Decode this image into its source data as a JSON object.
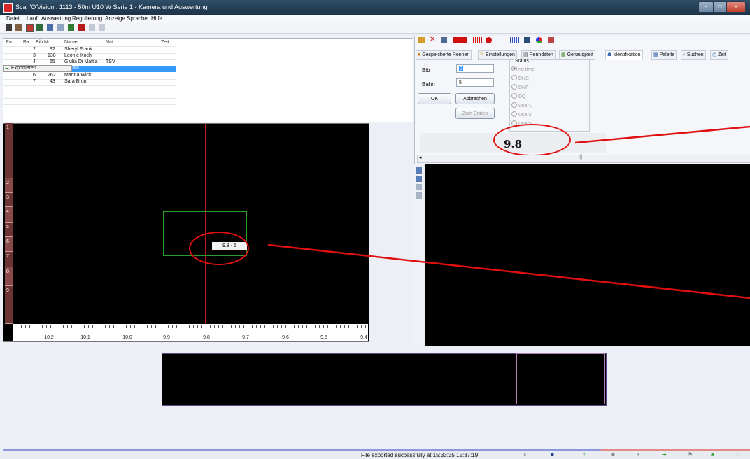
{
  "window": {
    "title": "Scan'O'Vision : 1113 - 50m  U10 W Serie 1 - Kamera und Auswertung"
  },
  "menu": [
    "Datei",
    "Lauf",
    "Auswertung",
    "Regulierung",
    "Anzeige",
    "Sprache",
    "Hilfe"
  ],
  "results_table": {
    "headers": [
      "Ra..",
      "Ba",
      "Bib Nr",
      "Name",
      "Nat",
      "Zeit"
    ],
    "rows": [
      {
        "lane": "2",
        "bib": "92",
        "name": "Sheryl Frank",
        "nat": ""
      },
      {
        "lane": "3",
        "bib": "138",
        "name": "Leonie Koch",
        "nat": ""
      },
      {
        "lane": "4",
        "bib": "65",
        "name": "Giulia Di Mattia",
        "nat": "TSV"
      },
      {
        "lane": "",
        "bib": "",
        "name": "e Gaul",
        "nat": ""
      },
      {
        "lane": "6",
        "bib": "262",
        "name": "Marina Wicki",
        "nat": ""
      },
      {
        "lane": "7",
        "bib": "43",
        "name": "Sara Brun",
        "nat": ""
      }
    ],
    "context_menu_item": "Exportieren"
  },
  "finish_view": {
    "lanes": [
      "1",
      "2",
      "3",
      "4",
      "5",
      "6",
      "7",
      "8",
      "9"
    ],
    "cursor_label": "9.8 - 5",
    "axis_ticks": [
      "10.2",
      "10.1",
      "10.0",
      "9.9",
      "9.8",
      "9.7",
      "9.6",
      "9.5",
      "9.4"
    ]
  },
  "tabs": [
    "Gespeicherte Rennen",
    "Einstellungen",
    "Renndaten",
    "Genauigkeit",
    "Identifikation",
    "Palette",
    "Suchen",
    "Zeit"
  ],
  "active_tab": "Identifikation",
  "identification": {
    "bib_label": "Bib",
    "bib_value": "0",
    "lane_label": "Bahn",
    "lane_value": "5",
    "ok": "OK",
    "cancel": "Abbrechen",
    "first": "Zum Ersten",
    "status_title": "Status",
    "status_options": [
      "no time",
      "DNS",
      "DNF",
      "DQ",
      "User1",
      "User2",
      "User3"
    ],
    "time_display": "9.8"
  },
  "statusbar": {
    "message": "File exported successfully at 15:33:35  15:37:19"
  },
  "colors": {
    "accent_red": "#e01010",
    "lane_color": "#8b4a4a",
    "selection": "#3399ff"
  }
}
